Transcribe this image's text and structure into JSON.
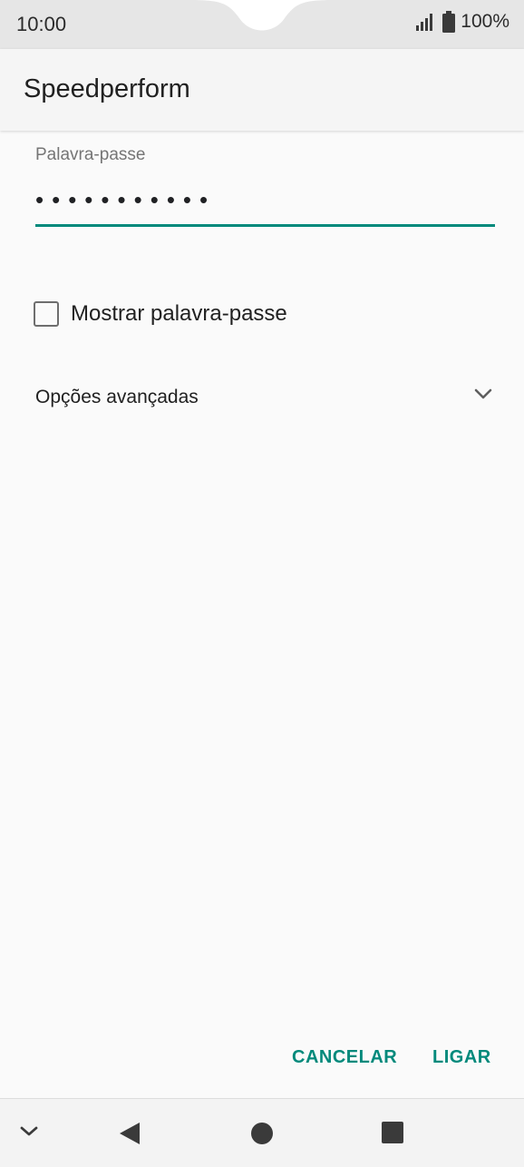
{
  "status_bar": {
    "time": "10:00",
    "battery_percent": "100%",
    "icons": [
      "signal-icon",
      "battery-icon"
    ]
  },
  "app_bar": {
    "title": "Speedperform"
  },
  "password": {
    "label": "Palavra-passe",
    "masked_value": "•••••••••••"
  },
  "show_password": {
    "label": "Mostrar palavra-passe",
    "checked": false
  },
  "advanced": {
    "label": "Opções avançadas",
    "icon": "chevron-down-icon"
  },
  "actions": {
    "cancel_label": "CANCELAR",
    "connect_label": "LIGAR"
  },
  "navigation": {
    "items": [
      "hide-keyboard-icon",
      "back-icon",
      "home-icon",
      "recents-icon"
    ]
  },
  "colors": {
    "accent": "#00897b",
    "background": "#fafafa",
    "status_bar": "#e6e6e6"
  }
}
